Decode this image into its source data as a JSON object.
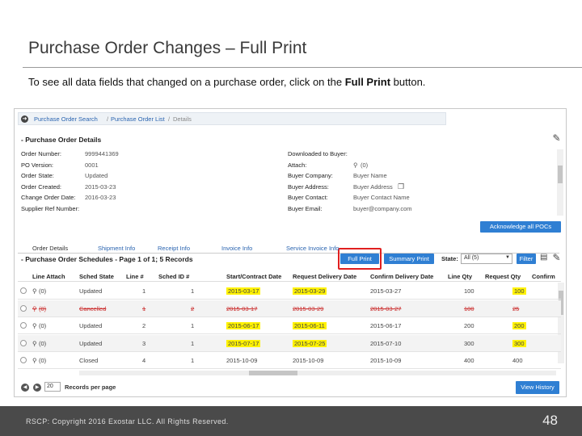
{
  "slide": {
    "title": "Purchase Order Changes – Full Print",
    "intro_prefix": "To see all data fields that changed on a purchase order, click on the ",
    "intro_bold": "Full Print",
    "intro_suffix": " button.",
    "copyright": "RSCP: Copyright 2016 Exostar LLC. All Rights Reserved.",
    "page_number": "48"
  },
  "breadcrumb": {
    "items": [
      "Purchase Order Search",
      "Purchase Order List"
    ],
    "separator": "/",
    "current": "Details"
  },
  "po_details": {
    "heading": "- Purchase Order Details",
    "left": [
      {
        "label": "Order Number:",
        "value": "9999441369"
      },
      {
        "label": "PO Version:",
        "value": "0001"
      },
      {
        "label": "Order State:",
        "value": "Updated"
      },
      {
        "label": "Order Created:",
        "value": "2015-03-23"
      },
      {
        "label": "Change Order Date:",
        "value": "2016-03-23"
      },
      {
        "label": "Supplier Ref Number:",
        "value": ""
      }
    ],
    "right": [
      {
        "label": "Downloaded to Buyer:",
        "value": ""
      },
      {
        "label": "Attach:",
        "value": "(0)"
      },
      {
        "label": "Buyer Company:",
        "value": "Buyer Name"
      },
      {
        "label": "Buyer Address:",
        "value": "Buyer Address"
      },
      {
        "label": "Buyer Contact:",
        "value": "Buyer Contact Name"
      },
      {
        "label": "Buyer Email:",
        "value": "buyer@company.com"
      }
    ],
    "acknowledge_label": "Acknowledge all POCs"
  },
  "tabs": [
    "Order Details",
    "Shipment Info",
    "Receipt Info",
    "Invoice Info",
    "Service Invoice Info"
  ],
  "schedules": {
    "heading": "- Purchase Order Schedules - Page 1 of 1; 5 Records",
    "full_print_label": "Full Print",
    "summary_print_label": "Summary Print",
    "state_label": "State:",
    "state_value": "All (5)",
    "filter_label": "Filter",
    "columns": [
      "Line Attach",
      "Sched State",
      "Line #",
      "Sched ID #",
      "Start/Contract Date",
      "Request Delivery Date",
      "Confirm Delivery Date",
      "Line Qty",
      "Request Qty",
      "Confirm"
    ],
    "rows": [
      {
        "attach": "(0)",
        "state": "Updated",
        "line": "1",
        "sched": "1",
        "start": "2015-03-17",
        "request": "2015-03-29",
        "confirm_date": "2015-03-27",
        "line_qty": "100",
        "req_qty": "100",
        "hl_start": true,
        "hl_request": true,
        "hl_qty": true,
        "struck": false
      },
      {
        "attach": "(0)",
        "state": "Cancelled",
        "line": "1",
        "sched": "2",
        "start": "2015-03-17",
        "request": "2015-03-29",
        "confirm_date": "2015-03-27",
        "line_qty": "100",
        "req_qty": "25",
        "hl_start": false,
        "hl_request": false,
        "hl_qty": false,
        "struck": true
      },
      {
        "attach": "(0)",
        "state": "Updated",
        "line": "2",
        "sched": "1",
        "start": "2015-06-17",
        "request": "2015-06-11",
        "confirm_date": "2015-06-17",
        "line_qty": "200",
        "req_qty": "200",
        "hl_start": true,
        "hl_request": true,
        "hl_qty": true,
        "struck": false
      },
      {
        "attach": "(0)",
        "state": "Updated",
        "line": "3",
        "sched": "1",
        "start": "2015-07-17",
        "request": "2015-07-25",
        "confirm_date": "2015-07-10",
        "line_qty": "300",
        "req_qty": "300",
        "hl_start": true,
        "hl_request": true,
        "hl_qty": true,
        "struck": false
      },
      {
        "attach": "(0)",
        "state": "Closed",
        "line": "4",
        "sched": "1",
        "start": "2015-10-09",
        "request": "2015-10-09",
        "confirm_date": "2015-10-09",
        "line_qty": "400",
        "req_qty": "400",
        "hl_start": false,
        "hl_request": false,
        "hl_qty": false,
        "struck": false
      }
    ],
    "per_page_value": "20",
    "per_page_label": "Records per page",
    "view_history_label": "View History"
  }
}
